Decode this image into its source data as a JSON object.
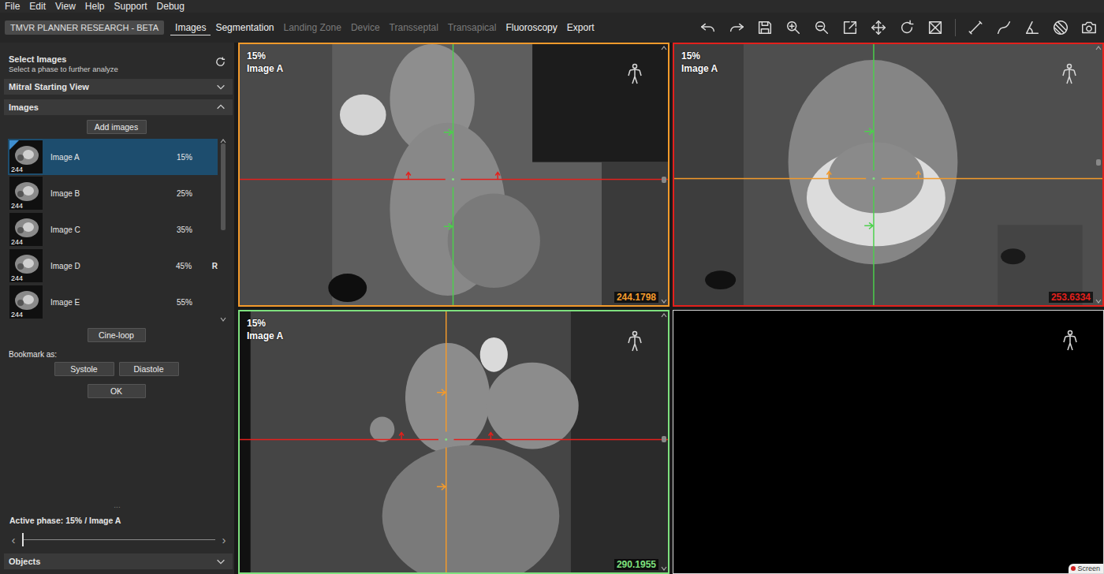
{
  "window": {
    "app_badge": "TMVR PLANNER RESEARCH - BETA"
  },
  "menu": [
    "File",
    "Edit",
    "View",
    "Help",
    "Support",
    "Debug"
  ],
  "tabs": [
    {
      "label": "Images",
      "selected": true,
      "disabled": false
    },
    {
      "label": "Segmentation",
      "selected": false,
      "disabled": false
    },
    {
      "label": "Landing Zone",
      "selected": false,
      "disabled": true
    },
    {
      "label": "Device",
      "selected": false,
      "disabled": true
    },
    {
      "label": "Transseptal",
      "selected": false,
      "disabled": true
    },
    {
      "label": "Transapical",
      "selected": false,
      "disabled": true
    },
    {
      "label": "Fluoroscopy",
      "selected": false,
      "disabled": false
    },
    {
      "label": "Export",
      "selected": false,
      "disabled": false
    }
  ],
  "panel": {
    "title": "Select Images",
    "subtitle": "Select a phase to further analyze",
    "sections": [
      {
        "label": "Mitral Starting View",
        "expanded": false
      },
      {
        "label": "Images",
        "expanded": true
      }
    ],
    "add_button": "Add images",
    "images": [
      {
        "name": "Image A",
        "phase": "15%",
        "slices": "244",
        "selected": true,
        "marker": ""
      },
      {
        "name": "Image B",
        "phase": "25%",
        "slices": "244",
        "selected": false,
        "marker": ""
      },
      {
        "name": "Image C",
        "phase": "35%",
        "slices": "244",
        "selected": false,
        "marker": ""
      },
      {
        "name": "Image D",
        "phase": "45%",
        "slices": "244",
        "selected": false,
        "marker": "R"
      },
      {
        "name": "Image E",
        "phase": "55%",
        "slices": "244",
        "selected": false,
        "marker": ""
      }
    ],
    "list_scroll": 0,
    "cine_button": "Cine-loop",
    "bookmark_label": "Bookmark as:",
    "bookmark_buttons": [
      "Systole",
      "Diastole"
    ],
    "ok_button": "OK",
    "divider": "...",
    "active_phase": "Active phase: 15% / Image A",
    "phase_slider": {
      "level": 0,
      "prev": "‹",
      "next": "›"
    },
    "objects_section": {
      "label": "Objects",
      "expanded": false
    }
  },
  "viewports": [
    {
      "kind": "image",
      "phase": "15%",
      "image": "Image A",
      "value": "244.1798",
      "color": "#f39a2b",
      "cross_v": "#4cd04c",
      "cross_h": "#e3201c",
      "scroll": 0.52
    },
    {
      "kind": "image",
      "phase": "15%",
      "image": "Image A",
      "value": "253.6334",
      "color": "#e3201c",
      "cross_v": "#4cd04c",
      "cross_h": "#f39a2b",
      "scroll": 0.45
    },
    {
      "kind": "image",
      "phase": "15%",
      "image": "Image A",
      "value": "290.1955",
      "color": "#7ee07e",
      "cross_v": "#f39a2b",
      "cross_h": "#e3201c",
      "scroll": 0.49
    },
    {
      "kind": "empty",
      "color": "#d8d8d8"
    }
  ],
  "watermark": "Screen"
}
